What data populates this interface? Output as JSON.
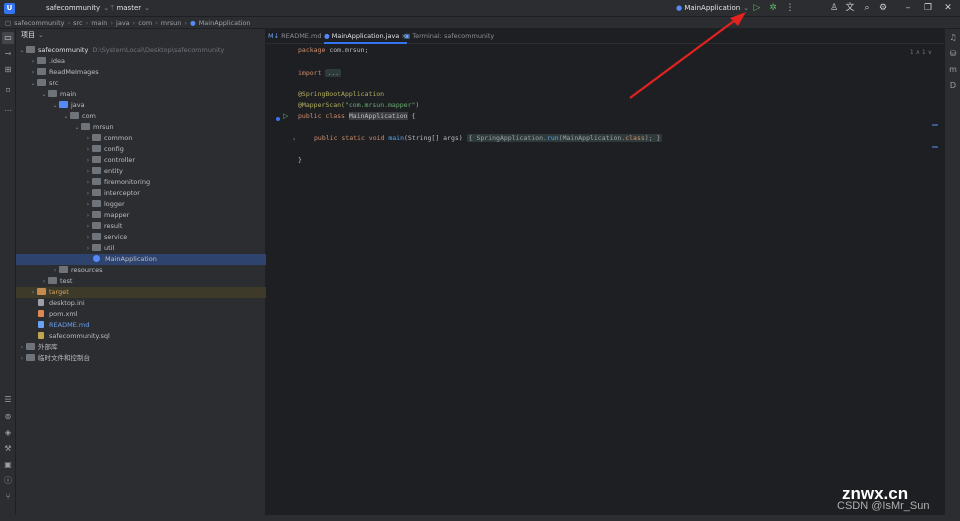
{
  "titlebar": {
    "logo": "U",
    "project": "safecommunity",
    "branch": "master",
    "run_config": "MainApplication"
  },
  "breadcrumb": [
    "safecommunity",
    "src",
    "main",
    "java",
    "com",
    "mrsun",
    "MainApplication"
  ],
  "project_panel": {
    "header": "项目",
    "root": "safecommunity",
    "root_path": "D:\\SystemLocal\\Desktop\\safecommunity",
    "tree": [
      {
        "label": ".idea",
        "indent": 1,
        "icon": "folder"
      },
      {
        "label": "ReadMeImages",
        "indent": 1,
        "icon": "folder"
      },
      {
        "label": "src",
        "indent": 1,
        "icon": "folder",
        "open": true
      },
      {
        "label": "main",
        "indent": 2,
        "icon": "folder",
        "open": true
      },
      {
        "label": "java",
        "indent": 3,
        "icon": "folder-blue",
        "open": true
      },
      {
        "label": "com",
        "indent": 4,
        "icon": "folder",
        "open": true
      },
      {
        "label": "mrsun",
        "indent": 5,
        "icon": "folder",
        "open": true
      },
      {
        "label": "common",
        "indent": 6,
        "icon": "folder"
      },
      {
        "label": "config",
        "indent": 6,
        "icon": "folder"
      },
      {
        "label": "controller",
        "indent": 6,
        "icon": "folder"
      },
      {
        "label": "entity",
        "indent": 6,
        "icon": "folder"
      },
      {
        "label": "firemonitoring",
        "indent": 6,
        "icon": "folder"
      },
      {
        "label": "interceptor",
        "indent": 6,
        "icon": "folder"
      },
      {
        "label": "logger",
        "indent": 6,
        "icon": "folder"
      },
      {
        "label": "mapper",
        "indent": 6,
        "icon": "folder"
      },
      {
        "label": "result",
        "indent": 6,
        "icon": "folder"
      },
      {
        "label": "service",
        "indent": 6,
        "icon": "folder"
      },
      {
        "label": "util",
        "indent": 6,
        "icon": "folder"
      },
      {
        "label": "MainApplication",
        "indent": 6,
        "icon": "java",
        "selected": true
      },
      {
        "label": "resources",
        "indent": 3,
        "icon": "folder"
      },
      {
        "label": "test",
        "indent": 2,
        "icon": "folder"
      },
      {
        "label": "target",
        "indent": 1,
        "icon": "folder-orange",
        "highlighted": true
      },
      {
        "label": "desktop.ini",
        "indent": 1,
        "icon": "file"
      },
      {
        "label": "pom.xml",
        "indent": 1,
        "icon": "xml"
      },
      {
        "label": "README.md",
        "indent": 1,
        "icon": "md"
      },
      {
        "label": "safecommunity.sql",
        "indent": 1,
        "icon": "sql"
      },
      {
        "label": "外部库",
        "indent": 0,
        "icon": "lib"
      },
      {
        "label": "临时文件和控制台",
        "indent": 0,
        "icon": "scratch"
      }
    ]
  },
  "editor": {
    "tabs": [
      {
        "label": "README.md",
        "active": false
      },
      {
        "label": "MainApplication.java",
        "active": true
      },
      {
        "label": "Terminal: safecommunity",
        "active": false
      }
    ],
    "reader_hint": "1 ∧ 1 ∨",
    "code": {
      "l1_kw": "package",
      "l1_rest": " com.mrsun;",
      "l3_kw": "import",
      "l3_fold": "...",
      "l5": "@SpringBootApplication",
      "l6_ann": "@MapperScan(",
      "l6_str": "\"com.mrsun.mapper\"",
      "l6_end": ")",
      "l7_kw": "public class ",
      "l7_cls": "MainApplication",
      "l7_end": " {",
      "l9_kw": "public static void ",
      "l9_fn": "main",
      "l9_args": "(String[] args) ",
      "l9_body_a": "{ SpringApplication.",
      "l9_body_fn": "run",
      "l9_body_b": "(MainApplication.",
      "l9_body_kw": "class",
      "l9_body_c": "); }",
      "l11": "}"
    }
  },
  "watermark": {
    "line1": "znwx.cn",
    "line2": "CSDN @IsMr_Sun"
  },
  "colors": {
    "accent": "#3574f0",
    "annotation_arrow": "#e0231f",
    "run_green": "#5fb865"
  }
}
